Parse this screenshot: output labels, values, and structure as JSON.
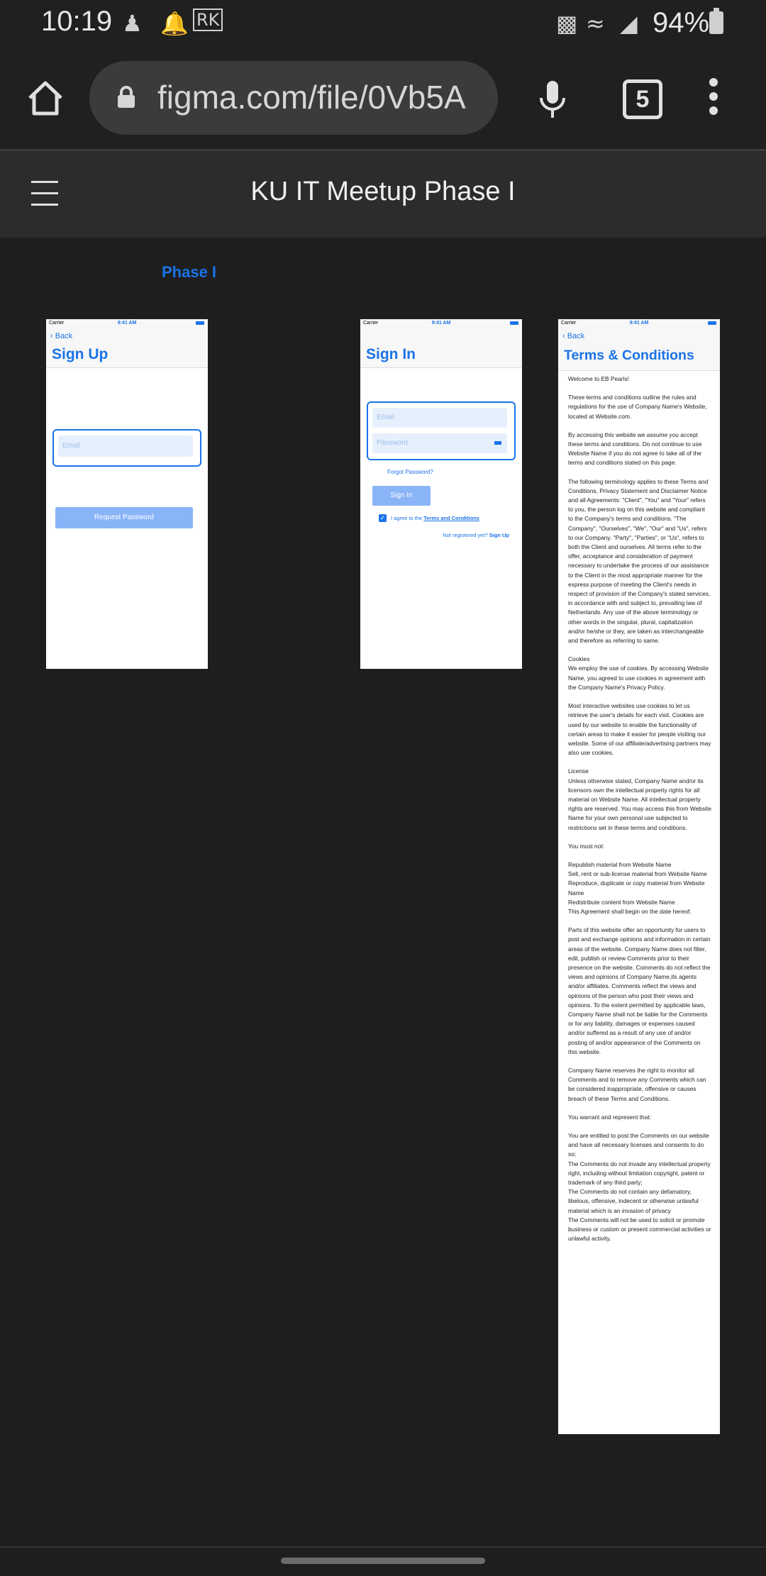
{
  "status_bar": {
    "time": "10:19",
    "battery": "94%",
    "icons": [
      "accessibility-icon",
      "bell-icon",
      "rk-app-icon",
      "battery-saver-icon",
      "wifi-icon",
      "signal-icon"
    ]
  },
  "browser": {
    "url": "figma.com/file/0Vb5A",
    "tab_count": "5"
  },
  "figma": {
    "file_title": "KU IT Meetup Phase I",
    "page_label": "Phase I"
  },
  "frames": {
    "common": {
      "carrier": "Carrier",
      "time": "9:41 AM",
      "back": "Back"
    },
    "signup": {
      "title": "Sign Up",
      "email_placeholder": "Email",
      "request_button": "Request Password"
    },
    "signin": {
      "title": "Sign In",
      "email_placeholder": "Email",
      "password_placeholder": "Password",
      "forgot": "Forgot Password?",
      "signin_button": "Sign In",
      "agree_prefix": "I agree to the",
      "agree_link": "Terms and Conditions",
      "not_registered": "Not registered yet?",
      "signup_link": "Sign Up"
    },
    "terms": {
      "title": "Terms & Conditions",
      "paragraphs": [
        "Welcome to EB Pearls!",
        "These terms and conditions outline the rules and regulations for the use of Company Name's Website, located at Website.com.",
        "By accessing this website we assume you accept these terms and conditions. Do not continue to use Website Name if you do not agree to take all of the terms and conditions stated on this page.",
        "The following terminology applies to these Terms and Conditions, Privacy Statement and Disclaimer Notice and all Agreements: \"Client\", \"You\" and \"Your\" refers to you, the person log on this website and compliant to the Company's terms and conditions. \"The Company\", \"Ourselves\", \"We\", \"Our\" and \"Us\", refers to our Company. \"Party\", \"Parties\", or \"Us\", refers to both the Client and ourselves. All terms refer to the offer, acceptance and consideration of payment necessary to undertake the process of our assistance to the Client in the most appropriate manner for the express purpose of meeting the Client's needs in respect of provision of the Company's stated services, in accordance with and subject to, prevailing law of Netherlands. Any use of the above terminology or other words in the singular, plural, capitalization and/or he/she or they, are taken as interchangeable and therefore as referring to same.",
        "Cookies\nWe employ the use of cookies. By accessing Website Name, you agreed to use cookies in agreement with the Company Name's Privacy Policy.",
        "Most interactive websites use cookies to let us retrieve the user's details for each visit. Cookies are used by our website to enable the functionality of certain areas to make it easier for people visiting our website. Some of our affiliate/advertising partners may also use cookies.",
        "License\nUnless otherwise stated, Company Name and/or its licensors own the intellectual property rights for all material on Website Name. All intellectual property rights are reserved. You may access this from Website Name for your own personal use subjected to restrictions set in these terms and conditions.",
        "You must not:",
        "Republish material from Website Name\nSell, rent or sub-license material from Website Name\nReproduce, duplicate or copy material from Website Name\nRedistribute content from Website Name\nThis Agreement shall begin on the date hereof.",
        "Parts of this website offer an opportunity for users to post and exchange opinions and information in certain areas of the website. Company Name does not filter, edit, publish or review Comments prior to their presence on the website. Comments do not reflect the views and opinions of Company Name,its agents and/or affiliates. Comments reflect the views and opinions of the person who post their views and opinions. To the extent permitted by applicable laws, Company Name shall not be liable for the Comments or for any liability, damages or expenses caused and/or suffered as a result of any use of and/or posting of and/or appearance of the Comments on this website.",
        "Company Name reserves the right to monitor all Comments and to remove any Comments which can be considered inappropriate, offensive or causes breach of these Terms and Conditions.",
        "You warrant and represent that:",
        "You are entitled to post the Comments on our website and have all necessary licenses and consents to do so;\nThe Comments do not invade any intellectual property right, including without limitation copyright, patent or trademark of any third party;\nThe Comments do not contain any defamatory, libelous, offensive, indecent or otherwise unlawful material which is an invasion of privacy\nThe Comments will not be used to solicit or promote business or custom or present commercial activities or unlawful activity."
      ]
    }
  }
}
